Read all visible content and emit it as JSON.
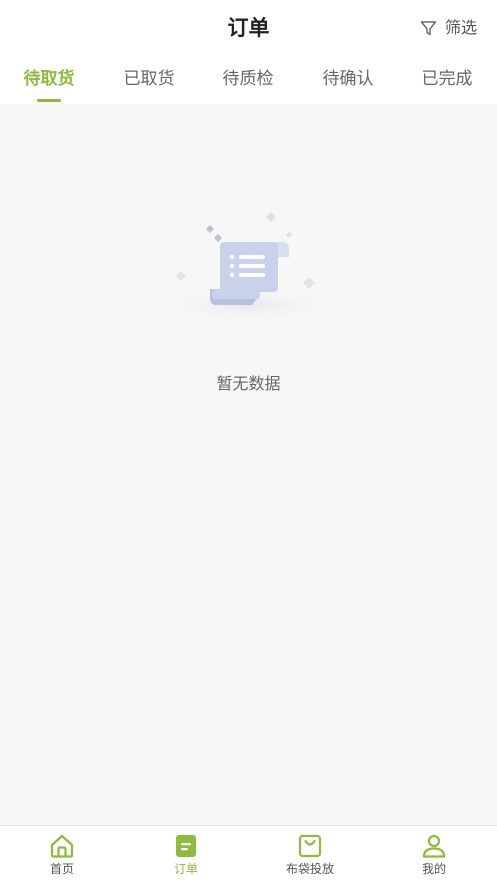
{
  "header": {
    "title": "订单",
    "filter_label": "筛选"
  },
  "tabs": [
    {
      "label": "待取货",
      "active": true
    },
    {
      "label": "已取货",
      "active": false
    },
    {
      "label": "待质检",
      "active": false
    },
    {
      "label": "待确认",
      "active": false
    },
    {
      "label": "已完成",
      "active": false
    }
  ],
  "empty_state": {
    "icon": "empty-scroll-icon",
    "text": "暂无数据"
  },
  "tabbar": {
    "items": [
      {
        "label": "首页",
        "icon": "home-icon",
        "active": false
      },
      {
        "label": "订单",
        "icon": "order-icon",
        "active": true
      },
      {
        "label": "布袋投放",
        "icon": "bag-icon",
        "active": false
      },
      {
        "label": "我的",
        "icon": "user-icon",
        "active": false
      }
    ]
  },
  "colors": {
    "accent": "#8dbb3d",
    "background": "#f7f7f7",
    "text_primary": "#222222",
    "text_secondary": "#666666"
  }
}
